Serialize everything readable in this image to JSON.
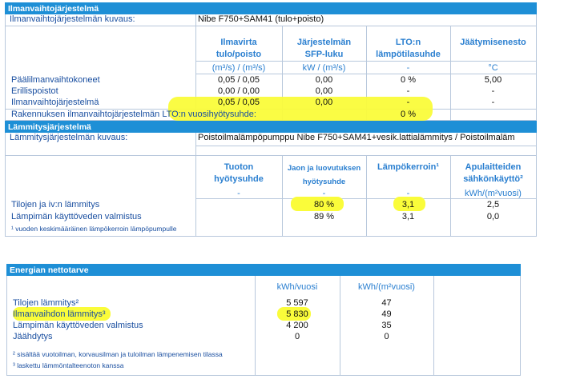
{
  "s1": {
    "title": "Ilmanvaihtojärjestelmä",
    "desc_label": "Ilmanvaihtojärjestelmän kuvaus:",
    "desc_value": "Nibe F750+SAM41 (tulo+poisto)",
    "cols": [
      {
        "h1": "Ilmavirta",
        "h2": "tulo/poisto",
        "unit": "(m³/s) / (m³/s)"
      },
      {
        "h1": "Järjestelmän",
        "h2": "SFP-luku",
        "unit": "kW / (m³/s)"
      },
      {
        "h1": "LTO:n",
        "h2": "lämpötilasuhde",
        "unit": "-"
      },
      {
        "h1": "Jäätymisenesto",
        "h2": "",
        "unit": "°C"
      }
    ],
    "rows": [
      {
        "label": "Päälilmanvaihtokoneet",
        "v": [
          "0,05 / 0,05",
          "0,00",
          "0 %",
          "5,00"
        ]
      },
      {
        "label": "Erillispoistot",
        "v": [
          "0,00 / 0,00",
          "0,00",
          "-",
          "-"
        ]
      },
      {
        "label": "Ilmanvaihtojärjestelmä",
        "v": [
          "0,05 / 0,05",
          "0,00",
          "-",
          "-"
        ]
      }
    ],
    "lto_label": "Rakennuksen ilmanvaihtojärjestelmän LTO:n vuosihyötysuhde:",
    "lto_value": "0 %"
  },
  "s2": {
    "title": "Lämmitysjärjestelmä",
    "desc_label": "Lämmitysjärjestelmän kuvaus:",
    "desc_value": "Poistoilmalämpöpumppu Nibe F750+SAM41+vesik.lattialämmitys / Poistoilmaläm",
    "cols": [
      {
        "h1": "Tuoton",
        "h2": "hyötysuhde",
        "unit": "-"
      },
      {
        "h1": "Jaon ja luovutuksen",
        "h2": "hyötysuhde",
        "unit": "-"
      },
      {
        "h1": "Lämpökerroin¹",
        "h2": "",
        "unit": "-"
      },
      {
        "h1": "Apulaitteiden",
        "h2": "sähkönkäyttö²",
        "unit": "kWh/(m²vuosi)"
      }
    ],
    "rows": [
      {
        "label": "Tilojen ja iv:n lämmitys",
        "v": [
          "",
          "80 %",
          "3,1",
          "2,5"
        ]
      },
      {
        "label": "Lämpimän käyttöveden valmistus",
        "v": [
          "",
          "89 %",
          "3,1",
          "0,0"
        ]
      }
    ],
    "note1": "¹ vuoden keskimääräinen lämpökerroin lämpöpumpulle"
  },
  "s3": {
    "title": "Energian nettotarve",
    "units": [
      "kWh/vuosi",
      "kWh/(m²vuosi)"
    ],
    "rows": [
      {
        "label": "Tilojen lämmitys²",
        "v": [
          "5 597",
          "47"
        ]
      },
      {
        "label": "Ilmanvaihdon lämmitys³",
        "v": [
          "5 830",
          "49"
        ]
      },
      {
        "label": "Lämpimän käyttöveden valmistus",
        "v": [
          "4 200",
          "35"
        ]
      },
      {
        "label": "Jäähdytys",
        "v": [
          "0",
          "0"
        ]
      }
    ],
    "note2": "² sisältää vuotoilman, korvausilman ja tuloilman lämpenemisen tilassa",
    "note3": "³ laskettu lämmöntalteenoton kanssa"
  }
}
